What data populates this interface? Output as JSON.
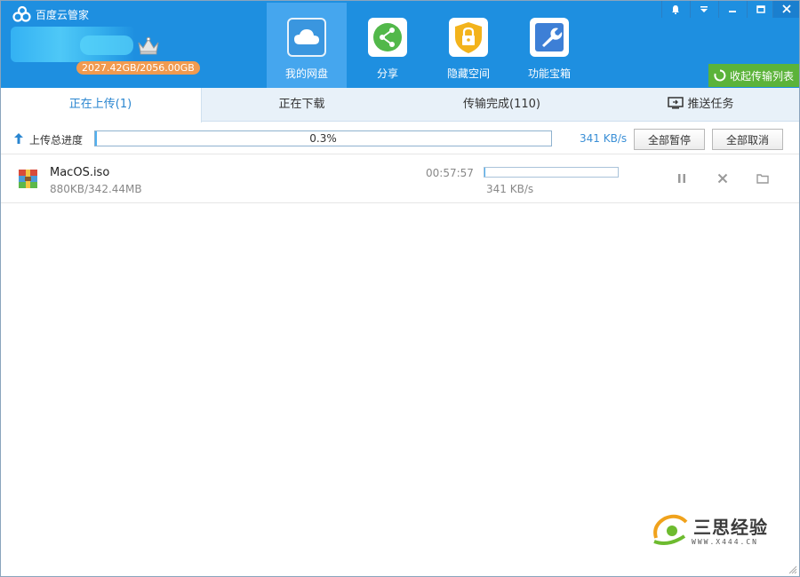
{
  "app": {
    "title": "百度云管家",
    "quota": "2027.42GB/2056.00GB"
  },
  "nav": [
    {
      "label": "我的网盘",
      "icon": "cloud-icon"
    },
    {
      "label": "分享",
      "icon": "share-icon"
    },
    {
      "label": "隐藏空间",
      "icon": "lock-icon"
    },
    {
      "label": "功能宝箱",
      "icon": "wrench-icon"
    }
  ],
  "header": {
    "collapse_label": "收起传输列表"
  },
  "tabs": [
    {
      "label": "正在上传(1)"
    },
    {
      "label": "正在下载"
    },
    {
      "label": "传输完成(110)"
    },
    {
      "label": "推送任务"
    }
  ],
  "total": {
    "label": "上传总进度",
    "progress_text": "0.3%",
    "progress": 0.003,
    "speed": "341 KB/s",
    "pause_all": "全部暂停",
    "cancel_all": "全部取消"
  },
  "file": {
    "name": "MacOS.iso",
    "size": "880KB/342.44MB",
    "remaining": "00:57:57",
    "progress": 0.003,
    "speed": "341 KB/s"
  },
  "watermark": {
    "text": "三思经验",
    "sub": "WWW.X444.CN"
  },
  "colors": {
    "header": "#1e8fe0",
    "accent": "#2a86d0",
    "green": "#5bb33a",
    "quota_badge": "#f19a4f"
  }
}
